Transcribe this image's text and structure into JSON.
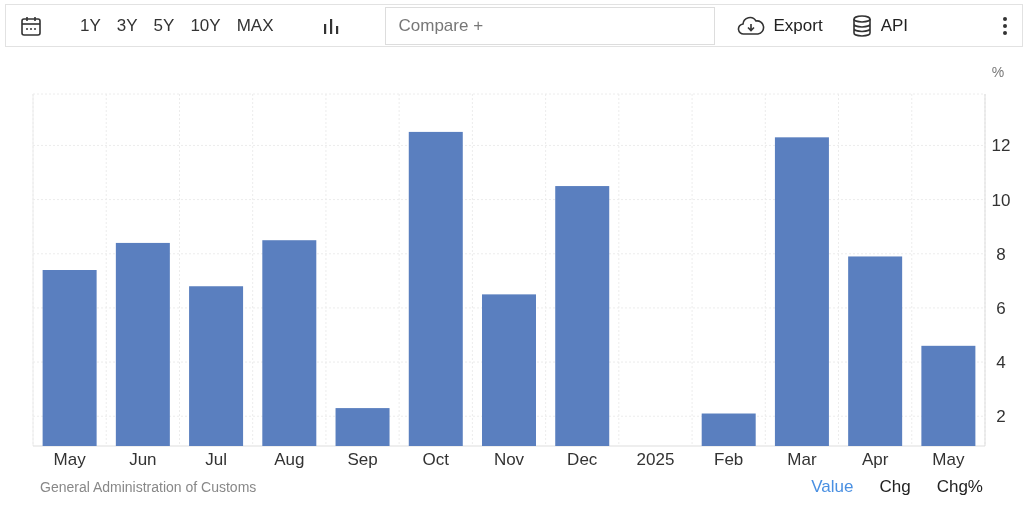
{
  "toolbar": {
    "ranges": [
      "1Y",
      "3Y",
      "5Y",
      "10Y",
      "MAX"
    ],
    "compare": {
      "placeholder": "Compare +"
    },
    "export": "Export",
    "api": "API"
  },
  "chart": {
    "unit": "%",
    "chart_data": {
      "type": "bar",
      "categories": [
        "May",
        "Jun",
        "Jul",
        "Aug",
        "Sep",
        "Oct",
        "Nov",
        "Dec",
        "2025",
        "Feb",
        "Mar",
        "Apr",
        "May"
      ],
      "series": [
        {
          "color": "#5a7fbf",
          "values": [
            7.4,
            8.4,
            6.8,
            8.5,
            2.3,
            12.5,
            6.5,
            10.5,
            null,
            2.1,
            12.3,
            7.9,
            4.6
          ]
        }
      ],
      "grid": true,
      "ylim": [
        0.9,
        13.9
      ],
      "yticks": [
        2,
        4,
        6,
        8,
        10,
        12
      ]
    }
  },
  "footer": {
    "source": "General Administration of Customs",
    "toggles": [
      {
        "label": "Value",
        "selected": true
      },
      {
        "label": "Chg",
        "selected": false
      },
      {
        "label": "Chg%",
        "selected": false
      }
    ]
  }
}
